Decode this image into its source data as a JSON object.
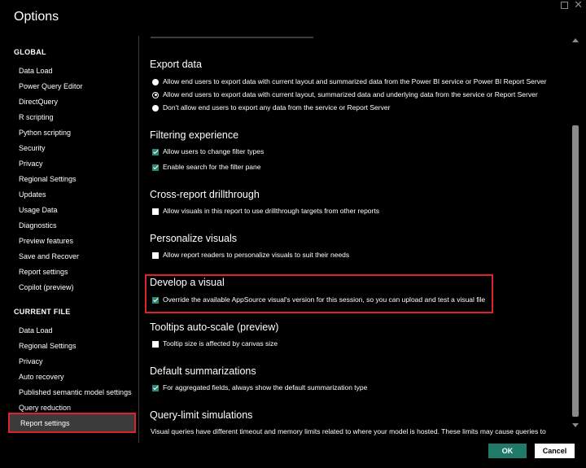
{
  "window": {
    "title": "Options"
  },
  "sidebar": {
    "global_heading": "GLOBAL",
    "global_items": [
      "Data Load",
      "Power Query Editor",
      "DirectQuery",
      "R scripting",
      "Python scripting",
      "Security",
      "Privacy",
      "Regional Settings",
      "Updates",
      "Usage Data",
      "Diagnostics",
      "Preview features",
      "Save and Recover",
      "Report settings",
      "Copilot (preview)"
    ],
    "current_file_heading": "CURRENT FILE",
    "current_file_items": [
      "Data Load",
      "Regional Settings",
      "Privacy",
      "Auto recovery",
      "Published semantic model settings",
      "Query reduction",
      "Report settings"
    ],
    "selected_item": "Report settings"
  },
  "content": {
    "export_data": {
      "title": "Export data",
      "options": [
        {
          "label": "Allow end users to export data with current layout and summarized data from the Power BI service or Power BI Report Server",
          "selected": false
        },
        {
          "label": "Allow end users to export data with current layout, summarized data and underlying data from the service or Report Server",
          "selected": true
        },
        {
          "label": "Don't allow end users to export any data from the service or Report Server",
          "selected": false
        }
      ]
    },
    "filtering_experience": {
      "title": "Filtering experience",
      "options": [
        {
          "label": "Allow users to change filter types",
          "checked": true
        },
        {
          "label": "Enable search for the filter pane",
          "checked": true
        }
      ]
    },
    "cross_report": {
      "title": "Cross-report drillthrough",
      "options": [
        {
          "label": "Allow visuals in this report to use drillthrough targets from other reports",
          "checked": false
        }
      ]
    },
    "personalize_visuals": {
      "title": "Personalize visuals",
      "options": [
        {
          "label": "Allow report readers to personalize visuals to suit their needs",
          "checked": false
        }
      ]
    },
    "develop_visual": {
      "title": "Develop a visual",
      "options": [
        {
          "label": "Override the available AppSource visual's version for this session, so you can upload and test a visual file",
          "checked": true
        }
      ]
    },
    "tooltips": {
      "title": "Tooltips auto-scale (preview)",
      "options": [
        {
          "label": "Tooltip size is affected by canvas size",
          "checked": false
        }
      ]
    },
    "default_summarizations": {
      "title": "Default summarizations",
      "options": [
        {
          "label": "For aggregated fields, always show the default summarization type",
          "checked": true
        }
      ]
    },
    "query_limit": {
      "title": "Query-limit simulations",
      "description": "Visual queries have different timeout and memory limits related to where your model is hosted. These limits may cause queries to"
    }
  },
  "footer": {
    "ok_label": "OK",
    "cancel_label": "Cancel"
  },
  "colors": {
    "accent_teal": "#1f7a6a",
    "highlight_red": "#e0202a",
    "selected_bg": "#3b3b3b"
  }
}
